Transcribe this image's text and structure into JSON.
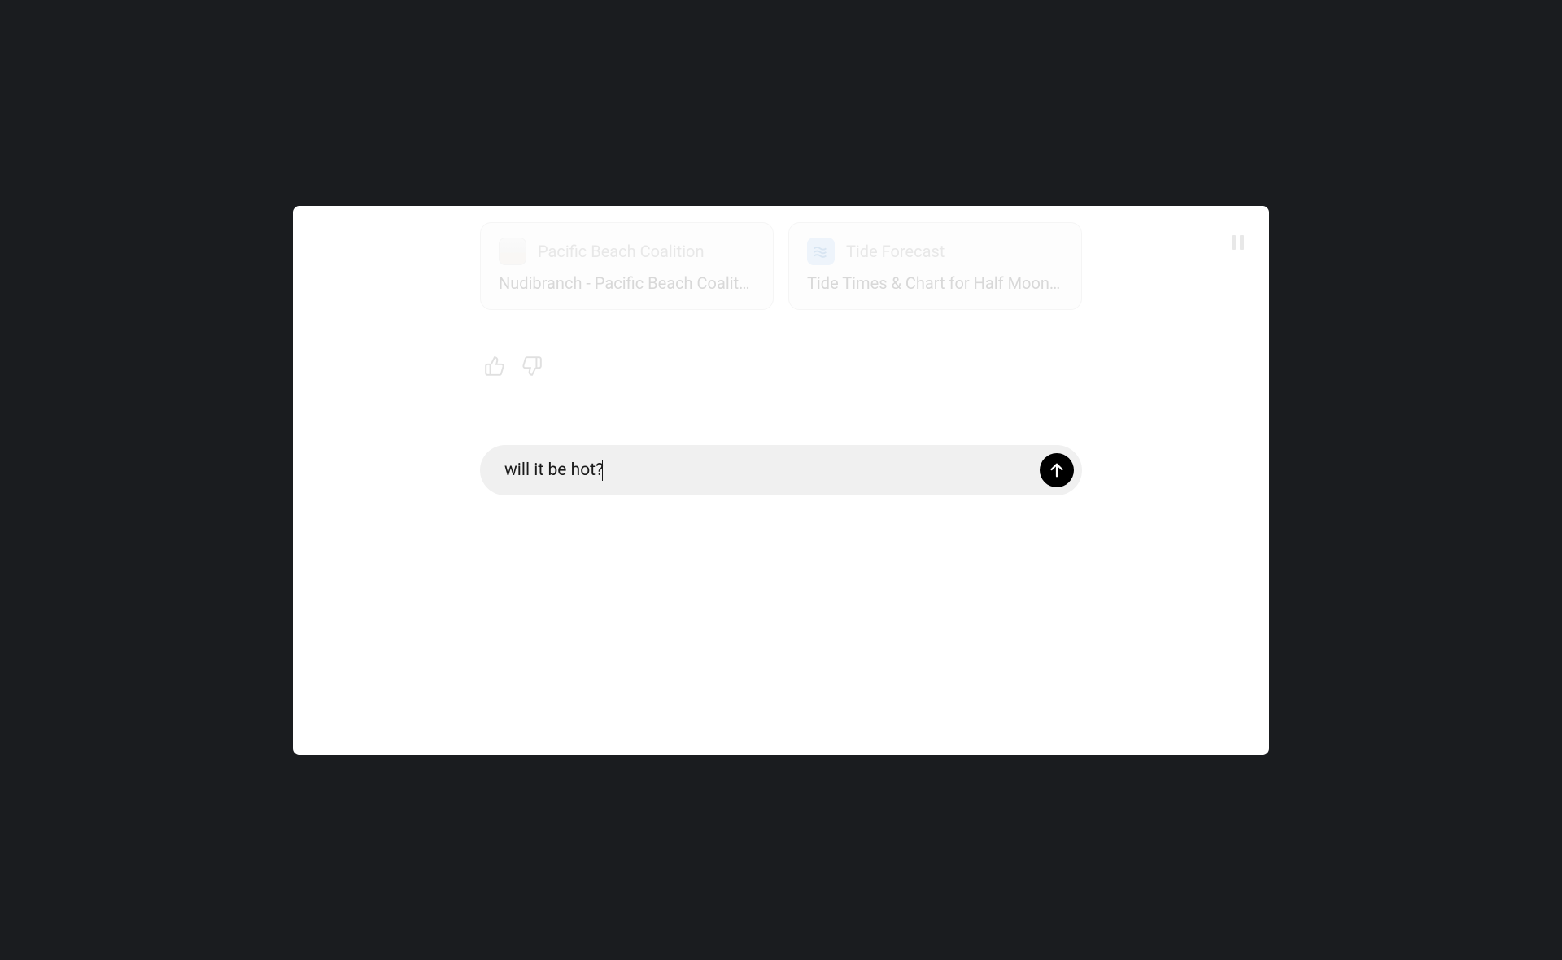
{
  "cards": [
    {
      "source": "Pacific Beach Coalition",
      "title": "Nudibranch - Pacific Beach Coalition",
      "icon_type": "beach"
    },
    {
      "source": "Tide Forecast",
      "title": "Tide Times & Chart for Half Moon Bay",
      "icon_type": "tide"
    }
  ],
  "input": {
    "value": "will it be hot?"
  }
}
